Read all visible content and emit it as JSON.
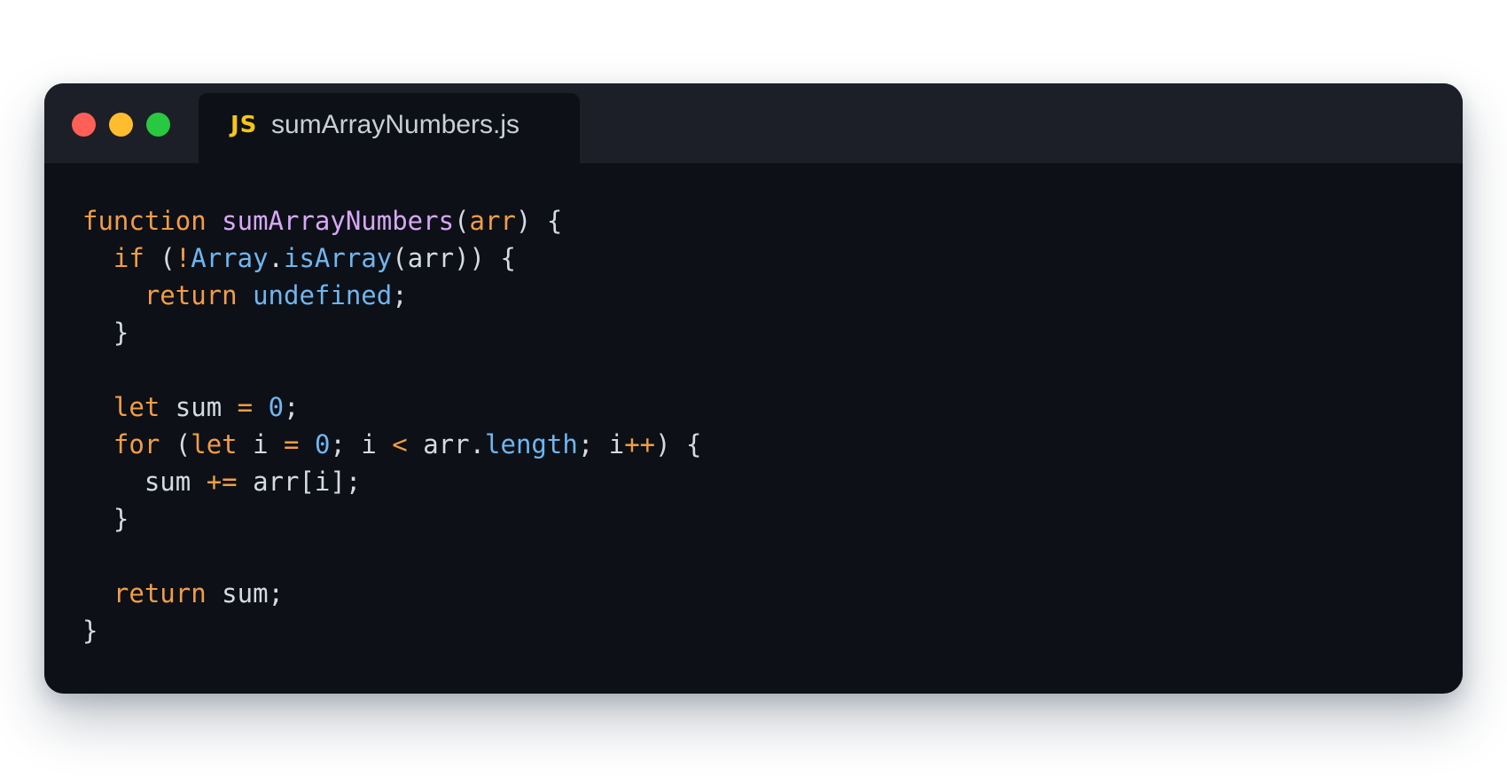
{
  "tab": {
    "icon": "JS",
    "filename": "sumArrayNumbers.js"
  },
  "code": {
    "lines": [
      [
        {
          "t": "function",
          "c": "kw"
        },
        {
          "t": " ",
          "c": "plain"
        },
        {
          "t": "sumArrayNumbers",
          "c": "fn"
        },
        {
          "t": "(",
          "c": "plain"
        },
        {
          "t": "arr",
          "c": "param"
        },
        {
          "t": ") {",
          "c": "plain"
        }
      ],
      [
        {
          "t": "  ",
          "c": "plain"
        },
        {
          "t": "if",
          "c": "kw"
        },
        {
          "t": " (",
          "c": "plain"
        },
        {
          "t": "!",
          "c": "op"
        },
        {
          "t": "Array",
          "c": "builtin"
        },
        {
          "t": ".",
          "c": "plain"
        },
        {
          "t": "isArray",
          "c": "builtin"
        },
        {
          "t": "(arr)) {",
          "c": "plain"
        }
      ],
      [
        {
          "t": "    ",
          "c": "plain"
        },
        {
          "t": "return",
          "c": "kw"
        },
        {
          "t": " ",
          "c": "plain"
        },
        {
          "t": "undefined",
          "c": "builtin"
        },
        {
          "t": ";",
          "c": "plain"
        }
      ],
      [
        {
          "t": "  }",
          "c": "plain"
        }
      ],
      [],
      [
        {
          "t": "  ",
          "c": "plain"
        },
        {
          "t": "let",
          "c": "kw"
        },
        {
          "t": " sum ",
          "c": "plain"
        },
        {
          "t": "=",
          "c": "op"
        },
        {
          "t": " ",
          "c": "plain"
        },
        {
          "t": "0",
          "c": "num"
        },
        {
          "t": ";",
          "c": "plain"
        }
      ],
      [
        {
          "t": "  ",
          "c": "plain"
        },
        {
          "t": "for",
          "c": "kw"
        },
        {
          "t": " (",
          "c": "plain"
        },
        {
          "t": "let",
          "c": "kw"
        },
        {
          "t": " i ",
          "c": "plain"
        },
        {
          "t": "=",
          "c": "op"
        },
        {
          "t": " ",
          "c": "plain"
        },
        {
          "t": "0",
          "c": "num"
        },
        {
          "t": "; i ",
          "c": "plain"
        },
        {
          "t": "<",
          "c": "op"
        },
        {
          "t": " arr.",
          "c": "plain"
        },
        {
          "t": "length",
          "c": "builtin"
        },
        {
          "t": "; i",
          "c": "plain"
        },
        {
          "t": "++",
          "c": "op"
        },
        {
          "t": ") {",
          "c": "plain"
        }
      ],
      [
        {
          "t": "    sum ",
          "c": "plain"
        },
        {
          "t": "+=",
          "c": "op"
        },
        {
          "t": " arr[i];",
          "c": "plain"
        }
      ],
      [
        {
          "t": "  }",
          "c": "plain"
        }
      ],
      [],
      [
        {
          "t": "  ",
          "c": "plain"
        },
        {
          "t": "return",
          "c": "kw"
        },
        {
          "t": " sum;",
          "c": "plain"
        }
      ],
      [
        {
          "t": "}",
          "c": "plain"
        }
      ]
    ]
  },
  "colors": {
    "window_bg": "#0d1017",
    "titlebar_bg": "#1c1f27",
    "keyword": "#f29d45",
    "function_name": "#d7a8f7",
    "builtin": "#6fb6f0",
    "text": "#d6dae2",
    "js_badge": "#f5c518"
  }
}
